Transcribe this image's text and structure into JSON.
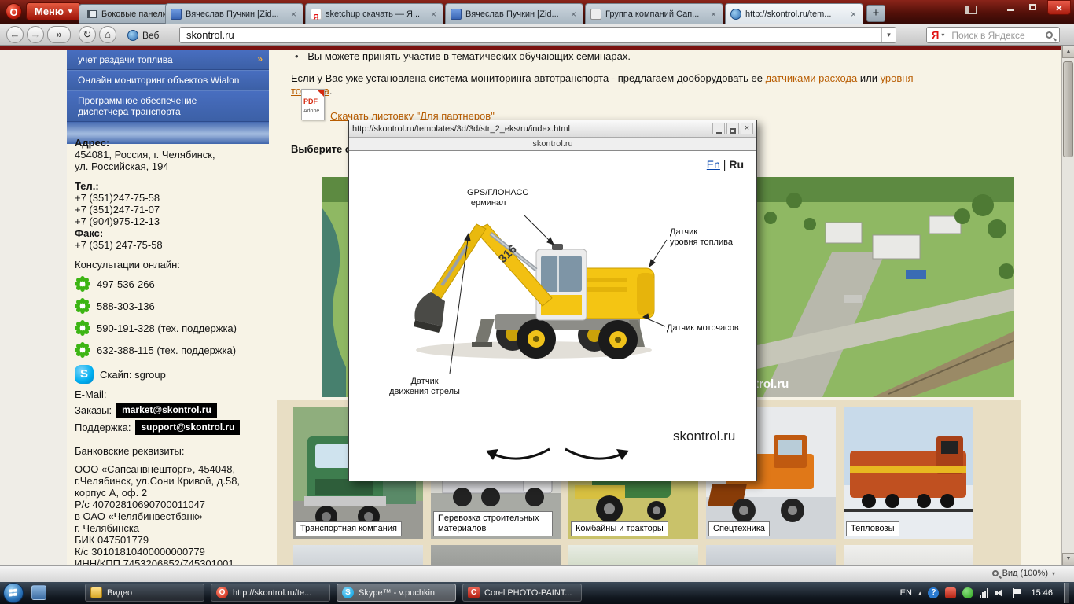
{
  "icons": {
    "opera_letter": "O",
    "caret_down": "▾",
    "back_arrow": "←",
    "forward_arrow": "→",
    "fast_forward": "»",
    "reload": "↻",
    "home": "⌂",
    "close": "×",
    "new_tab": "+",
    "bullet": "•",
    "menu_arrow": "»",
    "yandex_letter": "Я",
    "pdf_label": "PDF",
    "adobe_label": "Adobe",
    "scroll_up": "▲",
    "scroll_down": "▼",
    "tray_up": "▴",
    "help_question": "?",
    "skype_letter": "S",
    "corel_letter": "C"
  },
  "browser": {
    "menu_label": "Меню",
    "side_panels_label": "Боковые панели",
    "tabs": [
      {
        "title": "Вячеслав Пучкин [Zid..."
      },
      {
        "title": "sketchup скачать — Я..."
      },
      {
        "title": "Вячеслав Пучкин [Zid..."
      },
      {
        "title": "Группа компаний Сап..."
      },
      {
        "title": "http://skontrol.ru/tem..."
      }
    ],
    "web_label": "Веб",
    "address_value": "skontrol.ru",
    "search_placeholder": "Поиск в Яндексе",
    "status_zoom_label": "Вид (100%)"
  },
  "sidebar": {
    "menu": [
      "учет раздачи топлива",
      "Онлайн мониторинг объектов Wialon",
      "Программное обеспечение диспетчера транспорта"
    ],
    "address_label": "Адрес:",
    "address_line1": "454081, Россия, г. Челябинск,",
    "address_line2": "ул. Российская, 194",
    "phone_label": "Тел.:",
    "phone1": "+7 (351)247-75-58",
    "phone2": "+7 (351)247-71-07",
    "phone3": "+7 (904)975-12-13",
    "fax_label": "Факс:",
    "fax": "+7 (351) 247-75-58",
    "consult_label": "Консультации онлайн:",
    "icq": [
      "497-536-266",
      "588-303-136",
      "590-191-328 (тех. поддержка)",
      "632-388-115 (тех. поддержка)"
    ],
    "skype_line": "Скайп: sgroup",
    "email_label": "E-Mail:",
    "orders_label": "Заказы:",
    "orders_email": "market@skontrol.ru",
    "support_label": "Поддержка:",
    "support_email": "support@skontrol.ru",
    "bank_label": "Банковские реквизиты:",
    "bank_lines": [
      "ООО «Сапсанвнешторг», 454048,",
      "г.Челябинск, ул.Сони Кривой, д.58,",
      "корпус А, оф. 2",
      "Р/с 40702810690700011047",
      "в ОАО «Челябинвестбанк»",
      "г. Челябинска",
      "БИК 047501779",
      "К/с 30101810400000000779",
      "ИНН/КПП 7453206852/745301001"
    ]
  },
  "main": {
    "seminar_text": "Вы можете принять участие в тематических обучающих семинарах.",
    "retrofit_before": "Если у Вас уже установлена система мониторинга автотранспорта - предлагаем дооборудовать ее ",
    "link_flow": "датчиками расхода",
    "retrofit_or": " или ",
    "link_level": "уровня топлива",
    "retrofit_end": ".",
    "download_link": "Скачать листовку \"Для партнеров\"",
    "choose_heading": "Выберите с",
    "hero_watermark": "skontrol.ru",
    "cards": [
      {
        "label": "Транспортная компания"
      },
      {
        "label": "Перевозка строительных материалов"
      },
      {
        "label": "Комбайны и тракторы"
      },
      {
        "label": "Спецтехника"
      },
      {
        "label": "Тепловозы"
      }
    ]
  },
  "popup": {
    "titlebar_url": "http://skontrol.ru/templates/3d/3d/str_2_eks/ru/index.html",
    "site_header": "skontrol.ru",
    "lang_en": "En",
    "lang_sep": " | ",
    "lang_ru": "Ru",
    "machine_number": "316",
    "label_gps_line1": "GPS/ГЛОНАСС",
    "label_gps_line2": "терминал",
    "label_fuel_line1": "Датчик",
    "label_fuel_line2": "уровня топлива",
    "label_hours": "Датчик моточасов",
    "label_boom_line1": "Датчик",
    "label_boom_line2": "движения стрелы",
    "watermark": "skontrol.ru"
  },
  "taskbar": {
    "buttons": [
      {
        "label": "Видео"
      },
      {
        "label": "http://skontrol.ru/te..."
      },
      {
        "label": "Skype™ - v.puchkin"
      },
      {
        "label": "Corel PHOTO-PAINT..."
      }
    ],
    "tray_lang": "EN",
    "time": "15:46"
  }
}
